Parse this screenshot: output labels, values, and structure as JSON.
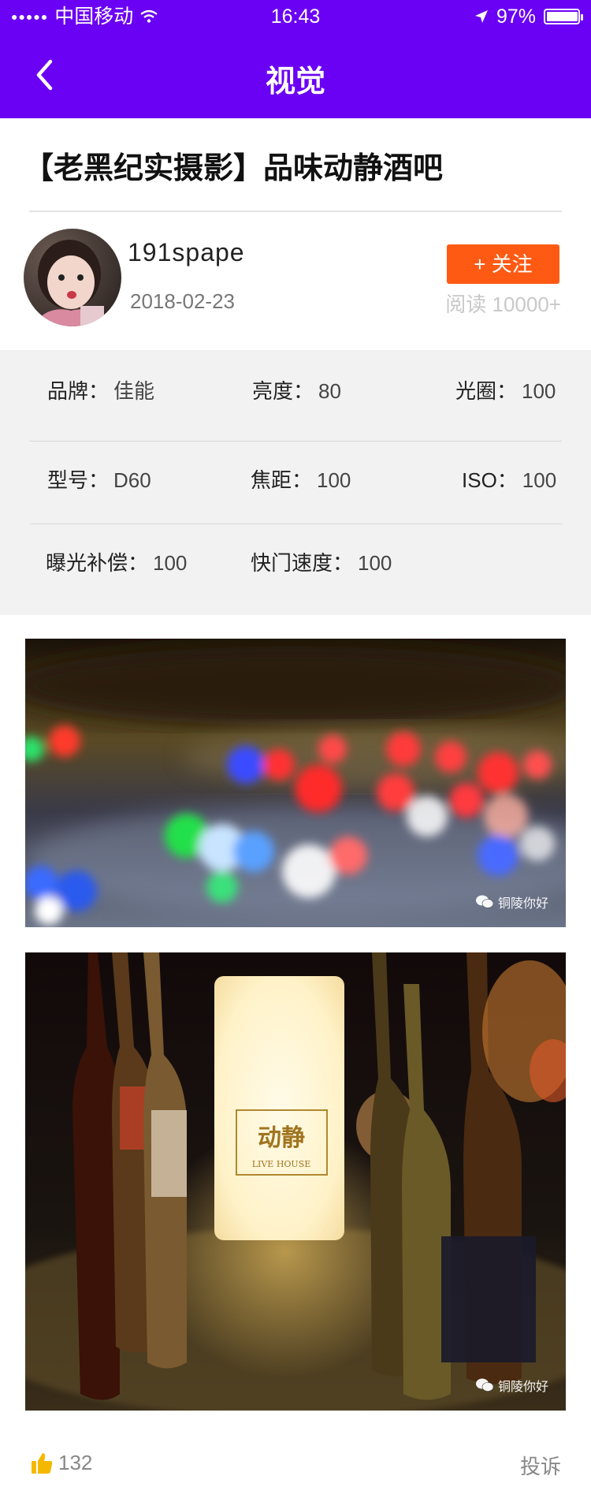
{
  "status_bar": {
    "carrier": "中国移动",
    "time": "16:43",
    "battery": "97%",
    "battery_level": 0.97
  },
  "navbar": {
    "title": "视觉"
  },
  "article": {
    "title": "【老黑纪实摄影】品味动静酒吧",
    "author": "191spape",
    "date": "2018-02-23",
    "follow_label": "+ 关注",
    "reads": "阅读 10000+"
  },
  "params": {
    "brand_label": "品牌：",
    "brand_value": "佳能",
    "brightness_label": "亮度：",
    "brightness_value": "80",
    "aperture_label": "光圈：",
    "aperture_value": "100",
    "model_label": "型号：",
    "model_value": "D60",
    "focal_label": "焦距：",
    "focal_value": "100",
    "iso_label": "ISO：",
    "iso_value": "100",
    "exposure_label": "曝光补偿：",
    "exposure_value": "100",
    "shutter_label": "快门速度：",
    "shutter_value": "100"
  },
  "photos": {
    "watermark_1": "铜陵你好",
    "sign_text": "LIVE HOUSE",
    "watermark_2": "铜陵你好"
  },
  "footer": {
    "likes": "132",
    "report_label": "投诉"
  },
  "colors": {
    "header": "#6a00f4",
    "follow_button": "#ff5a14",
    "panel_bg": "#f2f2f2",
    "like_icon": "#f5b800"
  }
}
